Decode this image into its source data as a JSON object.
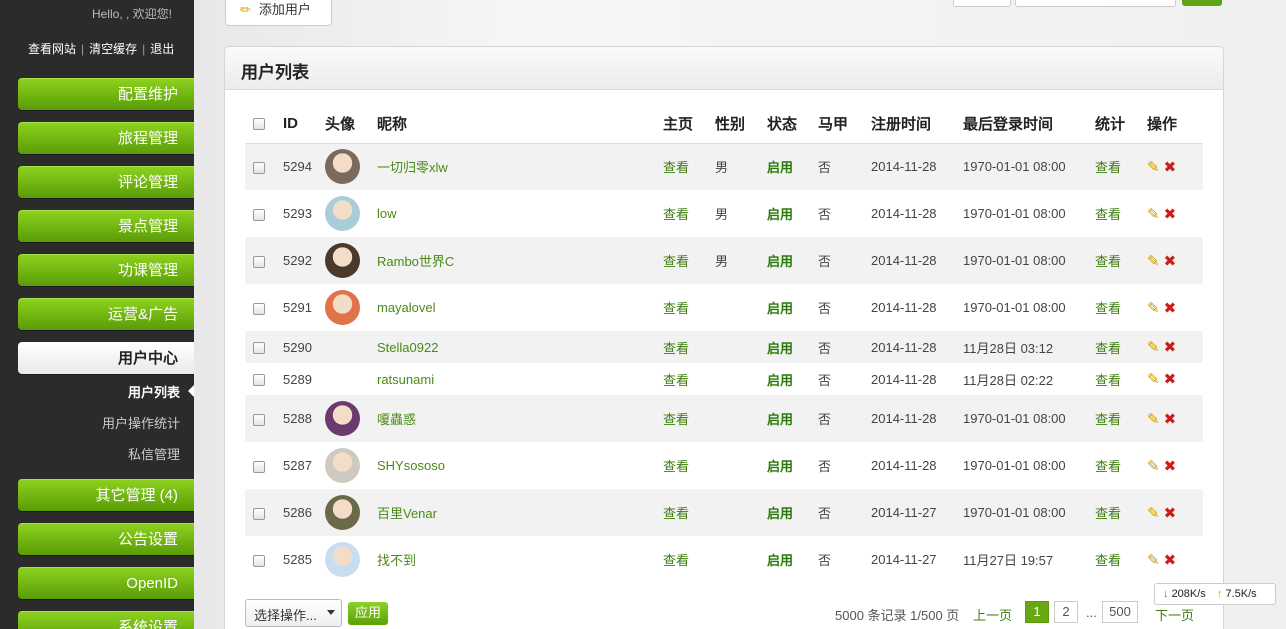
{
  "sidebar": {
    "greeting": "Hello, , 欢迎您!",
    "links": [
      "查看网站",
      "清空缓存",
      "退出"
    ],
    "menu": [
      {
        "label": "配置维护"
      },
      {
        "label": "旅程管理"
      },
      {
        "label": "评论管理"
      },
      {
        "label": "景点管理"
      },
      {
        "label": "功课管理"
      },
      {
        "label": "运营&广告"
      },
      {
        "label": "用户中心"
      },
      {
        "label": "其它管理 (4)"
      },
      {
        "label": "公告设置"
      },
      {
        "label": "OpenID"
      },
      {
        "label": "系统设置"
      }
    ],
    "submenu": [
      "用户列表",
      "用户操作统计",
      "私信管理"
    ]
  },
  "toolbar": {
    "add_label": "添加用户"
  },
  "panel": {
    "title": "用户列表"
  },
  "table": {
    "headers": [
      "ID",
      "头像",
      "昵称",
      "主页",
      "性别",
      "状态",
      "马甲",
      "注册时间",
      "最后登录时间",
      "统计",
      "操作"
    ],
    "rows": [
      {
        "id": "5294",
        "nick": "一切归零xlw",
        "home": "查看",
        "gender": "男",
        "status": "启用",
        "vest": "否",
        "reg": "2014-11-28",
        "last": "1970-01-01 08:00",
        "stat": "查看",
        "avatar_color": "#7a6a5e"
      },
      {
        "id": "5293",
        "nick": "low",
        "home": "查看",
        "gender": "男",
        "status": "启用",
        "vest": "否",
        "reg": "2014-11-28",
        "last": "1970-01-01 08:00",
        "stat": "查看",
        "avatar_color": "#a9cdd8"
      },
      {
        "id": "5292",
        "nick": "Rambo世界C",
        "home": "查看",
        "gender": "男",
        "status": "启用",
        "vest": "否",
        "reg": "2014-11-28",
        "last": "1970-01-01 08:00",
        "stat": "查看",
        "avatar_color": "#4a3a2a"
      },
      {
        "id": "5291",
        "nick": "mayalovel",
        "home": "查看",
        "gender": "",
        "status": "启用",
        "vest": "否",
        "reg": "2014-11-28",
        "last": "1970-01-01 08:00",
        "stat": "查看",
        "avatar_color": "#e0734a"
      },
      {
        "id": "5290",
        "nick": "Stella0922",
        "home": "查看",
        "gender": "",
        "status": "启用",
        "vest": "否",
        "reg": "2014-11-28",
        "last": "11月28日 03:12",
        "stat": "查看",
        "avatar_color": ""
      },
      {
        "id": "5289",
        "nick": "ratsunami",
        "home": "查看",
        "gender": "",
        "status": "启用",
        "vest": "否",
        "reg": "2014-11-28",
        "last": "11月28日 02:22",
        "stat": "查看",
        "avatar_color": ""
      },
      {
        "id": "5288",
        "nick": "嗄蟲惑",
        "home": "查看",
        "gender": "",
        "status": "启用",
        "vest": "否",
        "reg": "2014-11-28",
        "last": "1970-01-01 08:00",
        "stat": "查看",
        "avatar_color": "#6b3a6e"
      },
      {
        "id": "5287",
        "nick": "SHYsososo",
        "home": "查看",
        "gender": "",
        "status": "启用",
        "vest": "否",
        "reg": "2014-11-28",
        "last": "1970-01-01 08:00",
        "stat": "查看",
        "avatar_color": "#cfcac0"
      },
      {
        "id": "5286",
        "nick": "百里Venar",
        "home": "查看",
        "gender": "",
        "status": "启用",
        "vest": "否",
        "reg": "2014-11-27",
        "last": "1970-01-01 08:00",
        "stat": "查看",
        "avatar_color": "#6a6a48"
      },
      {
        "id": "5285",
        "nick": "找不到",
        "home": "查看",
        "gender": "",
        "status": "启用",
        "vest": "否",
        "reg": "2014-11-27",
        "last": "11月27日 19:57",
        "stat": "查看",
        "avatar_color": "#c9ddf0"
      }
    ]
  },
  "footer": {
    "action_select": "选择操作...",
    "apply": "应用",
    "count": "5000 条记录 1/500 页",
    "prev": "上一页",
    "pages": [
      "1",
      "2",
      "500"
    ],
    "dots": "...",
    "next": "下一页"
  },
  "speed": {
    "down": "208K/s",
    "up": "7.5K/s"
  }
}
